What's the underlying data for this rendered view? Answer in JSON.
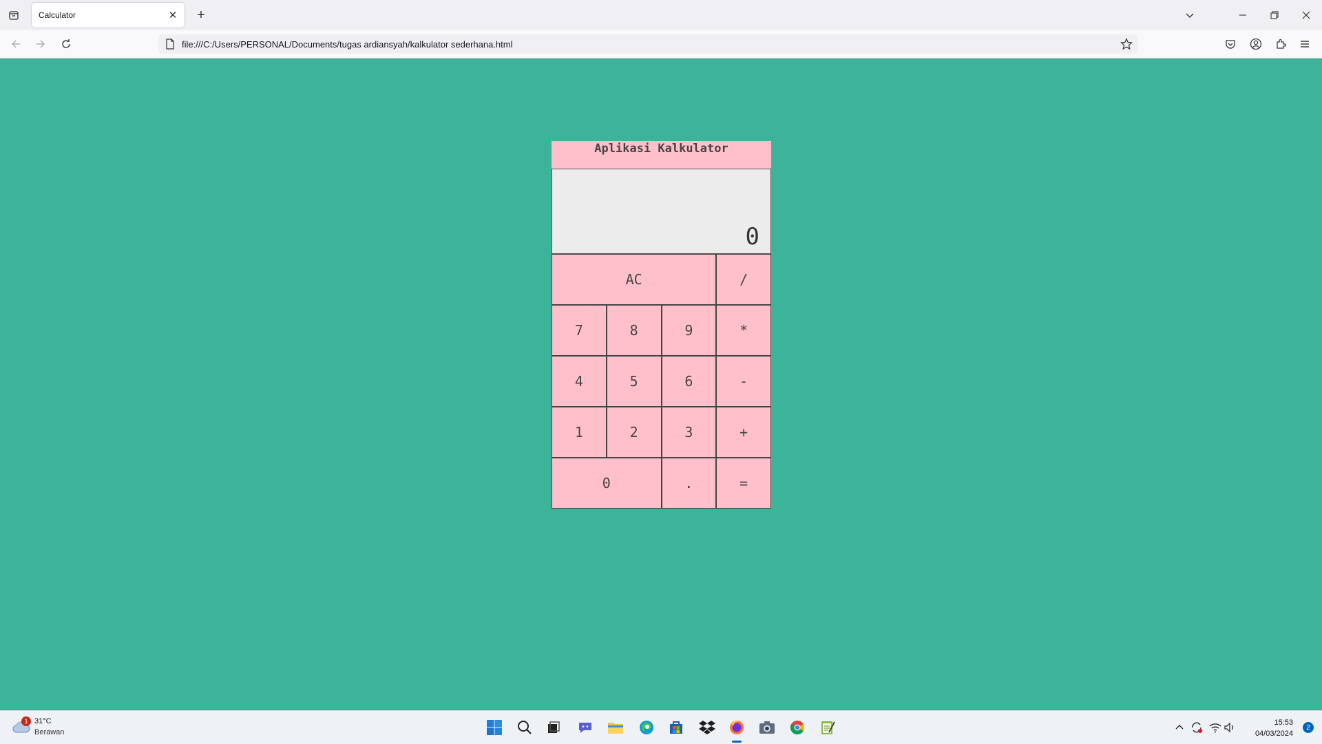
{
  "browser": {
    "tab_title": "Calculator",
    "tab_close": "✕",
    "new_tab": "+",
    "url": "file:///C:/Users/PERSONAL/Documents/tugas ardiansyah/kalkulator sederhana.html"
  },
  "calculator": {
    "title": "Aplikasi Kalkulator",
    "display_value": "0",
    "keys": {
      "clear": "AC",
      "divide": "/",
      "seven": "7",
      "eight": "8",
      "nine": "9",
      "multiply": "*",
      "four": "4",
      "five": "5",
      "six": "6",
      "minus": "-",
      "one": "1",
      "two": "2",
      "three": "3",
      "plus": "+",
      "zero": "0",
      "dot": ".",
      "equals": "="
    }
  },
  "taskbar": {
    "weather_temp": "31°C",
    "weather_desc": "Berawan",
    "weather_badge": "1",
    "time": "15:53",
    "date": "04/03/2024",
    "notification_count": "2"
  },
  "colors": {
    "page_background": "#3db39a",
    "calculator_pink": "#ffc0cb",
    "display_gray": "#ececec"
  }
}
